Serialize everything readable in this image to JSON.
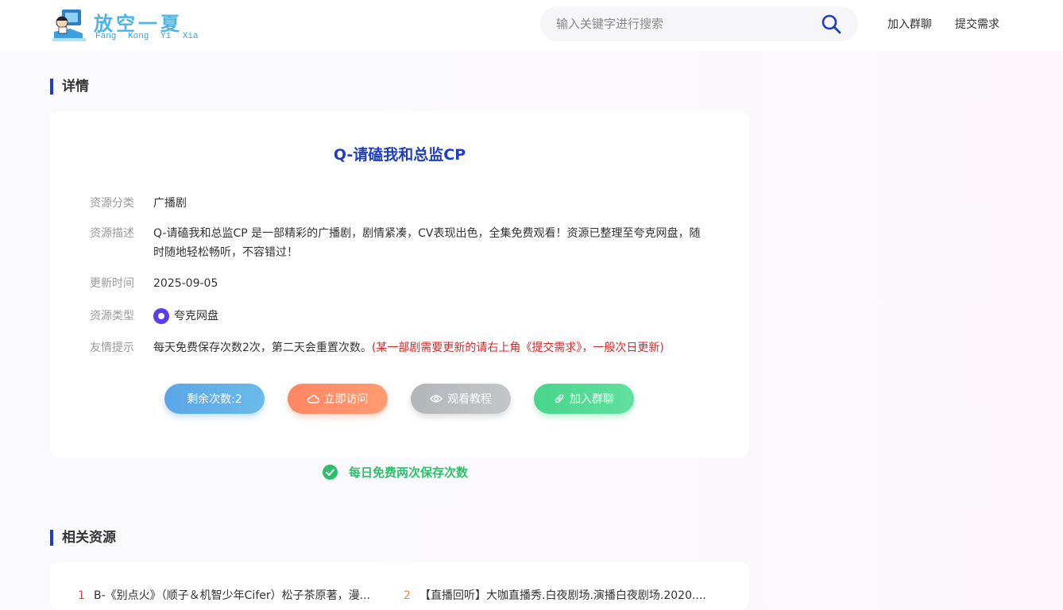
{
  "header": {
    "logo_title": "放空一夏",
    "logo_subtitle": "Fang Kong Yi Xia",
    "search_placeholder": "输入关键字进行搜索",
    "nav": [
      "加入群聊",
      "提交需求"
    ]
  },
  "detail": {
    "section_title": "详情",
    "title": "Q-请磕我和总监CP",
    "fields": {
      "category_label": "资源分类",
      "category_value": "广播剧",
      "desc_label": "资源描述",
      "desc_value": "Q-请磕我和总监CP 是一部精彩的广播剧，剧情紧凑，CV表现出色，全集免费观看！资源已整理至夸克网盘，随时随地轻松畅听，不容错过！",
      "update_label": "更新时间",
      "update_value": "2025-09-05",
      "type_label": "资源类型",
      "type_value": "夸克网盘",
      "tip_label": "友情提示",
      "tip_value": "每天免费保存次数2次，第二天会重置次数。",
      "tip_red": "(某一部剧需要更新的请右上角《提交需求》，一般次日更新)"
    },
    "buttons": {
      "remaining": "剩余次数:2",
      "visit": "立即访问",
      "tutorial": "观看教程",
      "join": "加入群聊"
    },
    "note": "每日免费两次保存次数"
  },
  "related": {
    "section_title": "相关资源",
    "items": [
      {
        "num": "1",
        "title": "B-《别点火》（顺子＆机智少年Cifer）松子茶原著，漫..."
      },
      {
        "num": "2",
        "title": "【直播回听】大咖直播秀.白夜剧场.演播白夜剧场.2020...."
      }
    ]
  },
  "colors": {
    "accent": "#1f3fbf",
    "logo": "#4fb3e6",
    "success": "#2fbf6a",
    "warning_text": "#d42a2a"
  }
}
